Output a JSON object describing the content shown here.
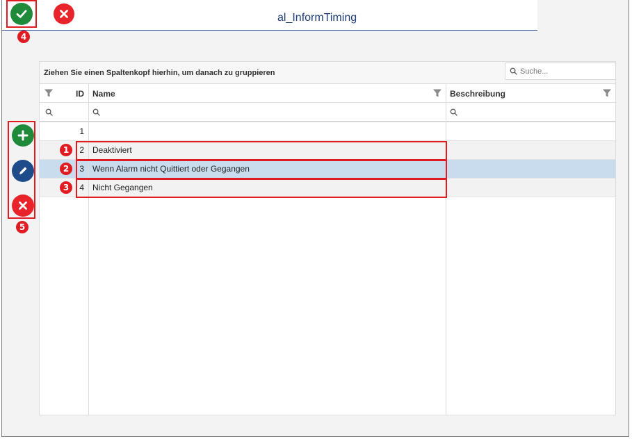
{
  "window": {
    "title": "al_InformTiming"
  },
  "toolbar": {
    "ok_icon": "check-icon",
    "cancel_icon": "close-icon"
  },
  "side_actions": [
    {
      "name": "add",
      "icon": "plus-icon",
      "color": "#1f8a3a"
    },
    {
      "name": "edit",
      "icon": "pencil-icon",
      "color": "#1e4c8a"
    },
    {
      "name": "delete",
      "icon": "close-icon",
      "color": "#e8232a"
    }
  ],
  "grid": {
    "group_panel_text": "Ziehen Sie einen Spaltenkopf hierhin, um danach zu gruppieren",
    "search_placeholder": "Suche...",
    "columns": [
      {
        "key": "id",
        "label": "ID"
      },
      {
        "key": "name",
        "label": "Name"
      },
      {
        "key": "description",
        "label": "Beschreibung"
      }
    ],
    "rows": [
      {
        "id": "1",
        "name": "",
        "description": "",
        "style": "normal"
      },
      {
        "id": "2",
        "name": "Deaktiviert",
        "description": "",
        "style": "alt"
      },
      {
        "id": "3",
        "name": "Wenn Alarm nicht Quittiert oder Gegangen",
        "description": "",
        "style": "selected"
      },
      {
        "id": "4",
        "name": "Nicht Gegangen",
        "description": "",
        "style": "alt"
      }
    ]
  },
  "annotations": {
    "badges": [
      "1",
      "2",
      "3",
      "4",
      "5"
    ]
  },
  "colors": {
    "accent_blue": "#1f3d7a",
    "ok_green": "#1f8a3a",
    "cancel_red": "#e8232a",
    "highlight_red": "#e01b22",
    "selection": "#c8dcee"
  }
}
